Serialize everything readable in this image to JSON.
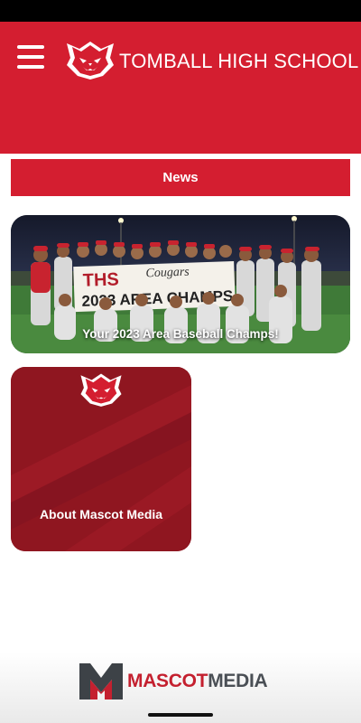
{
  "header": {
    "school_name": "TOMBALL HIGH SCHOOL",
    "menu_icon": "hamburger-menu-icon",
    "logo_icon": "cougar-logo-icon",
    "brand_color": "#d41e30"
  },
  "news": {
    "label": "News"
  },
  "feature": {
    "caption": "Your 2023 Area Baseball Champs!",
    "banner_line1": "THS",
    "banner_line1b": "Cougars",
    "banner_line2": "2023 AREA CHAMPS"
  },
  "about": {
    "label": "About Mascot Media",
    "card_color": "#8f1620"
  },
  "footer": {
    "brand_part1": "MASCOT",
    "brand_part2": "MEDIA"
  }
}
